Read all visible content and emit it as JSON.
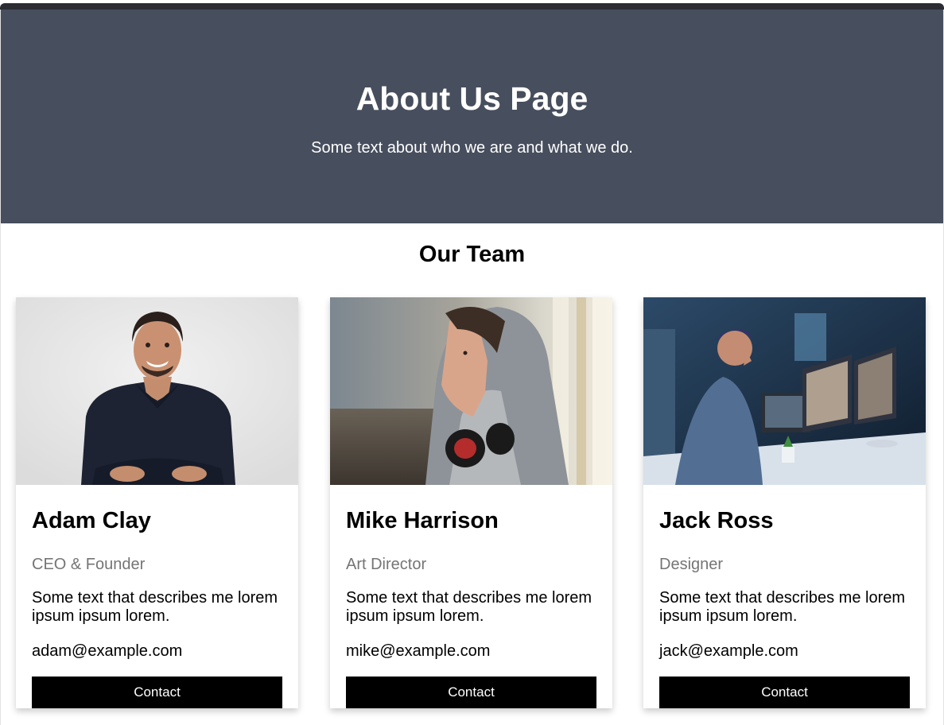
{
  "hero": {
    "title": "About Us Page",
    "subtitle": "Some text about who we are and what we do."
  },
  "team": {
    "heading": "Our Team",
    "members": [
      {
        "name": "Adam Clay",
        "role": "CEO & Founder",
        "description": "Some text that describes me lorem ipsum ipsum lorem.",
        "email": "adam@example.com",
        "button": "Contact"
      },
      {
        "name": "Mike Harrison",
        "role": "Art Director",
        "description": "Some text that describes me lorem ipsum ipsum lorem.",
        "email": "mike@example.com",
        "button": "Contact"
      },
      {
        "name": "Jack Ross",
        "role": "Designer",
        "description": "Some text that describes me lorem ipsum ipsum lorem.",
        "email": "jack@example.com",
        "button": "Contact"
      }
    ]
  },
  "colors": {
    "hero_bg": "#474e5d",
    "button_bg": "#000000",
    "role_text": "#757575"
  }
}
